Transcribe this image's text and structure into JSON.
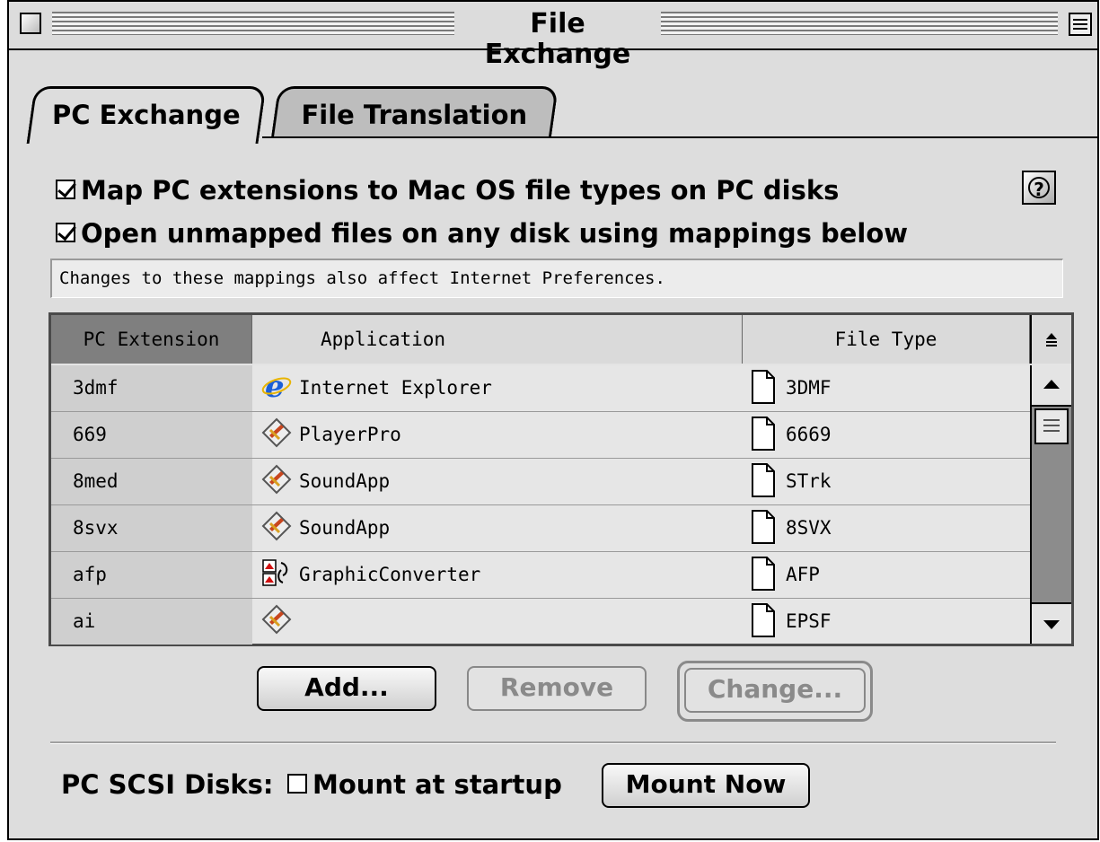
{
  "window": {
    "title": "File Exchange"
  },
  "tabs": [
    {
      "label": "PC Exchange",
      "selected": true
    },
    {
      "label": "File Translation",
      "selected": false
    }
  ],
  "options": {
    "map_extensions": {
      "label": "Map PC extensions to Mac OS file types on PC disks",
      "checked": true
    },
    "open_unmapped": {
      "label": "Open unmapped files on any disk using mappings below",
      "checked": true
    }
  },
  "help_icon": "help-icon",
  "notice": "Changes to these mappings also affect Internet Preferences.",
  "table": {
    "columns": [
      "PC Extension",
      "Application",
      "File Type"
    ],
    "sort_icon": "sort-direction-icon",
    "rows": [
      {
        "ext": "3dmf",
        "app": "Internet Explorer",
        "app_icon": "internet-explorer-icon",
        "type": "3DMF"
      },
      {
        "ext": "669",
        "app": "PlayerPro",
        "app_icon": "playerpro-icon",
        "type": "6669"
      },
      {
        "ext": "8med",
        "app": "SoundApp",
        "app_icon": "soundapp-icon",
        "type": "STrk"
      },
      {
        "ext": "8svx",
        "app": "SoundApp",
        "app_icon": "soundapp-icon",
        "type": "8SVX"
      },
      {
        "ext": "afp",
        "app": "GraphicConverter",
        "app_icon": "graphicconverter-icon",
        "type": "AFP"
      },
      {
        "ext": "ai",
        "app": "",
        "app_icon": "generic-app-icon",
        "type": "EPSF"
      }
    ]
  },
  "buttons": {
    "add": "Add...",
    "remove": "Remove",
    "change": "Change..."
  },
  "scsi": {
    "label": "PC SCSI Disks:",
    "mount_at_startup": {
      "label": "Mount at startup",
      "checked": false
    },
    "mount_now": "Mount Now"
  }
}
